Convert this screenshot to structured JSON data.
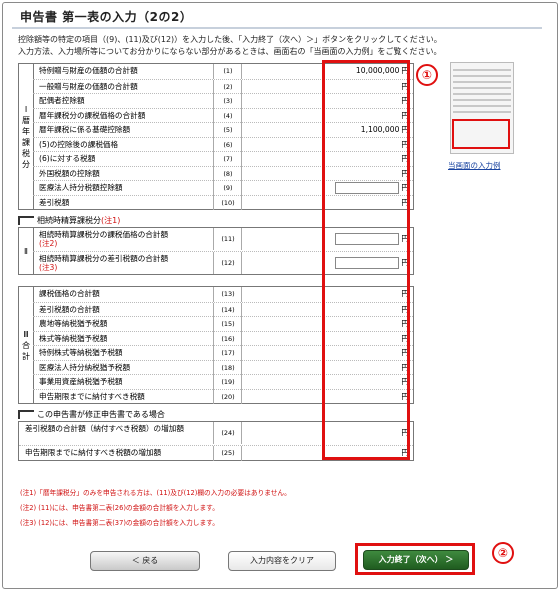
{
  "title": "申告書 第一表の入力（2の2）",
  "intro": [
    "控除額等の特定の項目（(9)、(11)及び(12)）を入力した後、「入力終了（次へ）＞」ボタンをクリックしてください。",
    "入力方法、入力場所等についてお分かりにならない部分があるときは、画面右の「当画面の入力例」をご覧ください。"
  ],
  "section1": {
    "label": [
      "Ⅰ",
      "暦",
      "年",
      "課",
      "税",
      "分"
    ],
    "rows": [
      {
        "label": "特例贈与財産の価額の合計額",
        "num": "(1)",
        "value": "10,000,000",
        "unit": "円"
      },
      {
        "label": "一般贈与財産の価額の合計額",
        "num": "(2)",
        "value": "",
        "unit": "円"
      },
      {
        "label": "配偶者控除額",
        "num": "(3)",
        "value": "",
        "unit": "円"
      },
      {
        "label": "暦年課税分の課税価格の合計額",
        "num": "(4)",
        "value": "",
        "unit": "円"
      },
      {
        "label": "暦年課税に係る基礎控除額",
        "num": "(5)",
        "value": "1,100,000",
        "unit": "円"
      },
      {
        "label": "(5)の控除後の課税価格",
        "num": "(6)",
        "value": "",
        "unit": "円"
      },
      {
        "label": "(6)に対する税額",
        "num": "(7)",
        "value": "",
        "unit": "円"
      },
      {
        "label": "外国税額の控除額",
        "num": "(8)",
        "value": "",
        "unit": "円"
      },
      {
        "label": "医療法人持分税額控除額",
        "num": "(9)",
        "value": "",
        "unit": "円",
        "input": true
      },
      {
        "label": "差引税額",
        "num": "(10)",
        "value": "",
        "unit": "円"
      }
    ]
  },
  "section2": {
    "heading": "相続時精算課税分",
    "heading_note": "(注1)",
    "label": [
      "Ⅱ"
    ],
    "rows": [
      {
        "label": "相続時精算課税分の課税価格の合計額",
        "note": "(注2)",
        "num": "(11)",
        "unit": "円"
      },
      {
        "label": "相続時精算課税分の差引税額の合計額",
        "note": "(注3)",
        "num": "(12)",
        "unit": "円"
      }
    ]
  },
  "section3": {
    "label": [
      "Ⅲ",
      "合",
      "計"
    ],
    "rows": [
      {
        "label": "課税価格の合計額",
        "num": "(13)",
        "unit": "円"
      },
      {
        "label": "差引税額の合計額",
        "num": "(14)",
        "unit": "円"
      },
      {
        "label": "農地等納税猶予税額",
        "num": "(15)",
        "unit": "円"
      },
      {
        "label": "株式等納税猶予税額",
        "num": "(16)",
        "unit": "円"
      },
      {
        "label": "特例株式等納税猶予税額",
        "num": "(17)",
        "unit": "円"
      },
      {
        "label": "医療法人持分納税猶予税額",
        "num": "(18)",
        "unit": "円"
      },
      {
        "label": "事業用資産納税猶予税額",
        "num": "(19)",
        "unit": "円"
      },
      {
        "label": "申告期限までに納付すべき税額",
        "num": "(20)",
        "unit": "円"
      }
    ]
  },
  "section4": {
    "heading": "この申告書が修正申告書である場合",
    "rows": [
      {
        "label": "差引税額の合計額（納付すべき税額）の増加額",
        "num": "(24)",
        "unit": "円"
      },
      {
        "label": "申告期限までに納付すべき税額の増加額",
        "num": "(25)",
        "unit": "円"
      }
    ]
  },
  "notes": [
    "(注1)「暦年課税分」のみを申告される方は、(11)及び(12)欄の入力の必要はありません。",
    "(注2) (11)には、申告書第二表(26)の金額の合計額を入力します。",
    "(注3) (12)には、申告書第二表(37)の金額の合計額を入力します。"
  ],
  "sidebar": {
    "example_link": "当画面の入力例"
  },
  "markers": {
    "one": "①",
    "two": "②"
  },
  "buttons": {
    "back": "＜ 戻る",
    "clear": "入力内容をクリア",
    "next": "入力終了（次へ） ＞"
  }
}
